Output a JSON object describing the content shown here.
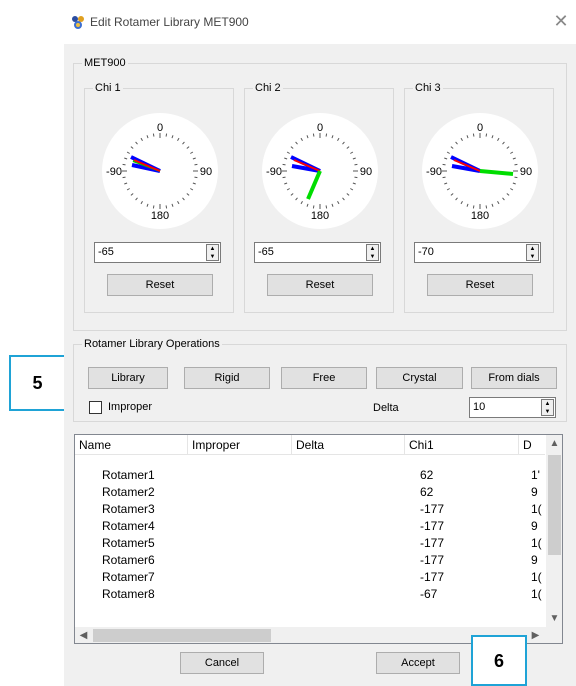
{
  "window": {
    "title": "Edit Rotamer Library MET900"
  },
  "main_group": {
    "title": "MET900",
    "chis": [
      {
        "title": "Chi 1",
        "value": "-65",
        "reset_label": "Reset",
        "labels": {
          "top": "0",
          "left": "-90",
          "right": "90",
          "bottom": "180"
        }
      },
      {
        "title": "Chi 2",
        "value": "-65",
        "reset_label": "Reset",
        "labels": {
          "top": "0",
          "left": "-90",
          "right": "90",
          "bottom": "180"
        }
      },
      {
        "title": "Chi 3",
        "value": "-70",
        "reset_label": "Reset",
        "labels": {
          "top": "0",
          "left": "-90",
          "right": "90",
          "bottom": "180"
        }
      }
    ]
  },
  "operations": {
    "title": "Rotamer Library Operations",
    "buttons": [
      "Library",
      "Rigid",
      "Free",
      "Crystal",
      "From dials"
    ],
    "improper_label": "Improper",
    "delta_label": "Delta",
    "delta_value": "10"
  },
  "table": {
    "headers": [
      "Name",
      "Improper",
      "Delta",
      "Chi1",
      "D"
    ],
    "rows": [
      {
        "name": "Rotamer1",
        "improper": "",
        "delta": "",
        "chi1": "62",
        "d": "1'"
      },
      {
        "name": "Rotamer2",
        "improper": "",
        "delta": "",
        "chi1": "62",
        "d": "9"
      },
      {
        "name": "Rotamer3",
        "improper": "",
        "delta": "",
        "chi1": "-177",
        "d": "1("
      },
      {
        "name": "Rotamer4",
        "improper": "",
        "delta": "",
        "chi1": "-177",
        "d": "9"
      },
      {
        "name": "Rotamer5",
        "improper": "",
        "delta": "",
        "chi1": "-177",
        "d": "1("
      },
      {
        "name": "Rotamer6",
        "improper": "",
        "delta": "",
        "chi1": "-177",
        "d": "9"
      },
      {
        "name": "Rotamer7",
        "improper": "",
        "delta": "",
        "chi1": "-177",
        "d": "1("
      },
      {
        "name": "Rotamer8",
        "improper": "",
        "delta": "",
        "chi1": "-67",
        "d": "1("
      }
    ]
  },
  "footer": {
    "cancel_label": "Cancel",
    "accept_label": "Accept"
  },
  "callouts": {
    "left": "5",
    "accept": "6"
  },
  "colors": {
    "accent": "#1fa3d6",
    "dial_red": "#ff0000",
    "dial_blue": "#0000ff",
    "dial_green": "#00dd00"
  },
  "icons": {
    "app": "app-icon",
    "close": "close-icon",
    "spin_up": "spin-up-icon",
    "spin_down": "spin-down-icon"
  }
}
